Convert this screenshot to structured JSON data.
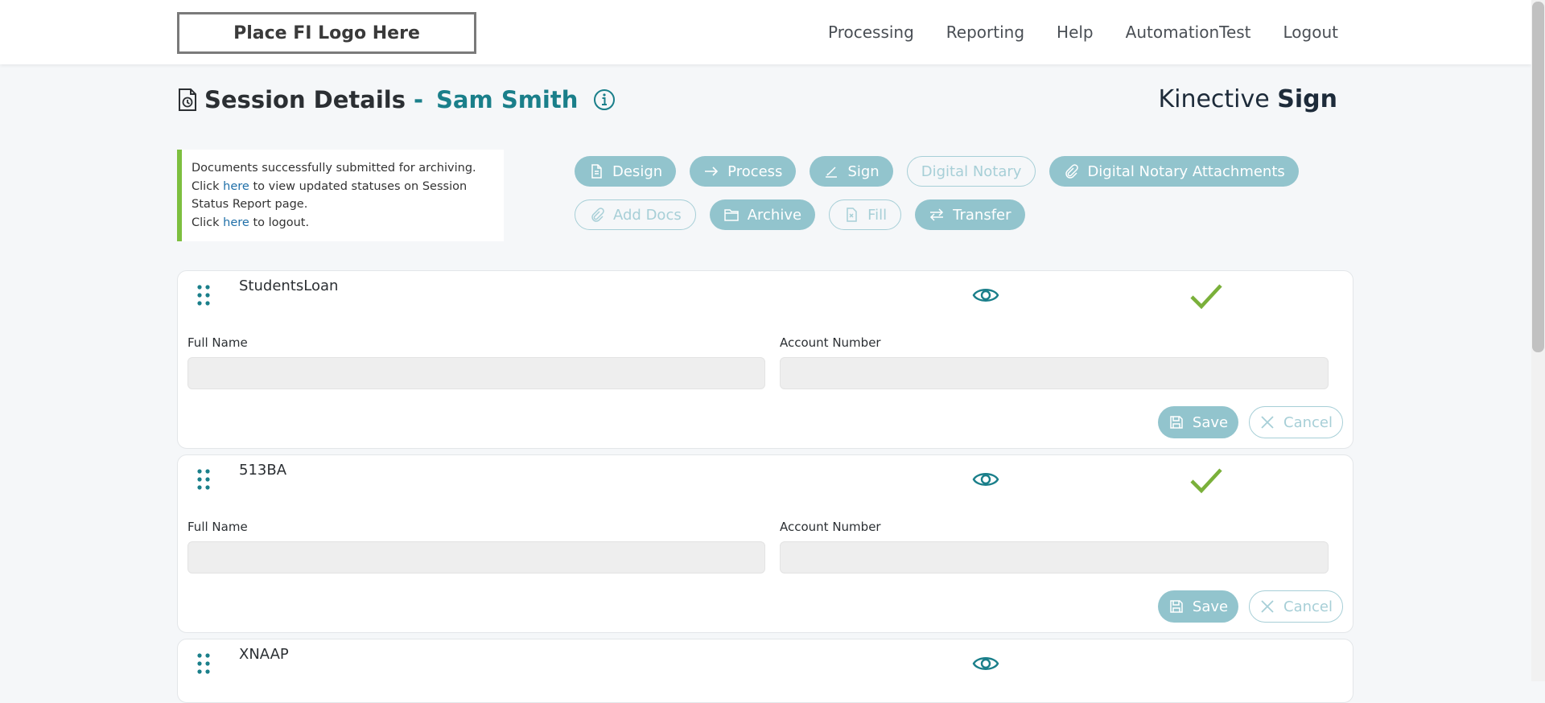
{
  "header": {
    "logo_text": "Place FI Logo Here",
    "nav": [
      {
        "label": "Processing"
      },
      {
        "label": "Reporting"
      },
      {
        "label": "Help"
      },
      {
        "label": "AutomationTest"
      },
      {
        "label": "Logout"
      }
    ]
  },
  "page": {
    "title": "Session Details",
    "separator": "-",
    "signer_name": "Sam Smith",
    "brand_regular": "Kinective",
    "brand_bold": "Sign"
  },
  "message": {
    "line1": "Documents successfully submitted for archiving.",
    "line2_pre": "Click ",
    "line2_link": "here",
    "line2_post": " to view updated statuses on Session Status Report page.",
    "line3_pre": "Click ",
    "line3_link": "here",
    "line3_post": " to logout."
  },
  "actions": {
    "row1": [
      {
        "label": "Design",
        "style": "filled",
        "icon": "document-icon"
      },
      {
        "label": "Process",
        "style": "filled",
        "icon": "arrow-right-icon"
      },
      {
        "label": "Sign",
        "style": "filled",
        "icon": "pen-icon"
      },
      {
        "label": "Digital Notary",
        "style": "outline",
        "icon": ""
      },
      {
        "label": "Digital Notary Attachments",
        "style": "filled",
        "icon": "paperclip-icon"
      }
    ],
    "row2": [
      {
        "label": "Add Docs",
        "style": "outline",
        "icon": "paperclip-icon"
      },
      {
        "label": "Archive",
        "style": "filled",
        "icon": "folder-icon"
      },
      {
        "label": "Fill",
        "style": "outline",
        "icon": "fill-icon"
      },
      {
        "label": "Transfer",
        "style": "filled",
        "icon": "transfer-icon"
      }
    ]
  },
  "documents": [
    {
      "name": "StudentsLoan",
      "complete": true,
      "full_name_label": "Full Name",
      "full_name_value": "",
      "account_label": "Account Number",
      "account_value": "",
      "save_label": "Save",
      "cancel_label": "Cancel"
    },
    {
      "name": "513BA",
      "complete": true,
      "full_name_label": "Full Name",
      "full_name_value": "",
      "account_label": "Account Number",
      "account_value": "",
      "save_label": "Save",
      "cancel_label": "Cancel"
    },
    {
      "name": "XNAAP",
      "complete": false
    }
  ],
  "colors": {
    "accent": "#1a7f8a",
    "button_fill": "#92c4cd",
    "success_check": "#7ab03a",
    "message_border": "#7dbf3f"
  }
}
